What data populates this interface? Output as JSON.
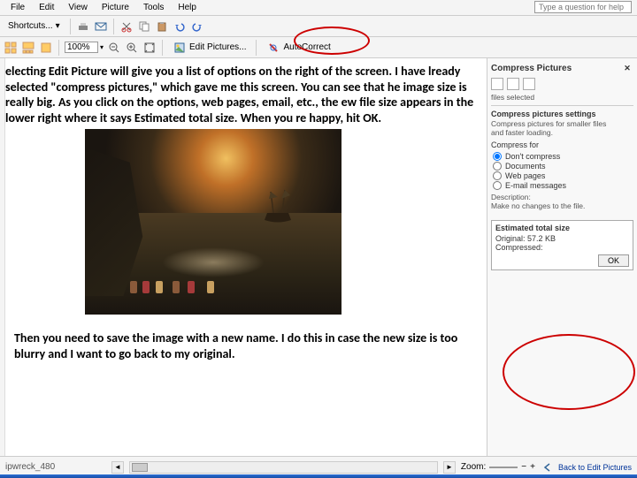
{
  "menu": {
    "items": [
      "File",
      "Edit",
      "View",
      "Picture",
      "Tools",
      "Help"
    ]
  },
  "questionbox_placeholder": "Type a question for help",
  "toolbar1": {
    "shortcuts_label": "Shortcuts..."
  },
  "toolbar2": {
    "zoom_value": "100%",
    "edit_pictures_label": "Edit Pictures...",
    "auto_correct_label": "AutoCorrect"
  },
  "body": {
    "para1": "electing Edit Picture will give you a list of options on the right of the screen.    I have lready selected \"compress pictures,\" which gave me this screen.     You can see that he image size is really big. As you click on the options,     web pages, email, etc., the ew file size appears in the lower right where it says Estimated total size. When you re happy, hit OK.",
    "para2": "Then you need to save the image with a new name. I do this in case the new size is too blurry and I want to go back to my original."
  },
  "taskpane": {
    "title": "Compress Pictures",
    "files_selected": "files selected",
    "settings_title": "Compress pictures settings",
    "settings_desc1": "Compress pictures for smaller files",
    "settings_desc2": "and faster loading.",
    "compress_for_label": "Compress for",
    "radios": [
      "Don't compress",
      "Documents",
      "Web pages",
      "E-mail messages"
    ],
    "radio_selected_index": 0,
    "description_label": "Description:",
    "description_text": "Make no changes to the file.",
    "est_title": "Estimated total size",
    "est_original_label": "Original:",
    "est_original_value": "57.2 KB",
    "est_compressed_label": "Compressed:",
    "ok_label": "OK"
  },
  "statusbar": {
    "filename": "ipwreck_480",
    "zoom_label": "Zoom:",
    "zoom_link": "",
    "back_label": "Back to Edit Pictures"
  }
}
